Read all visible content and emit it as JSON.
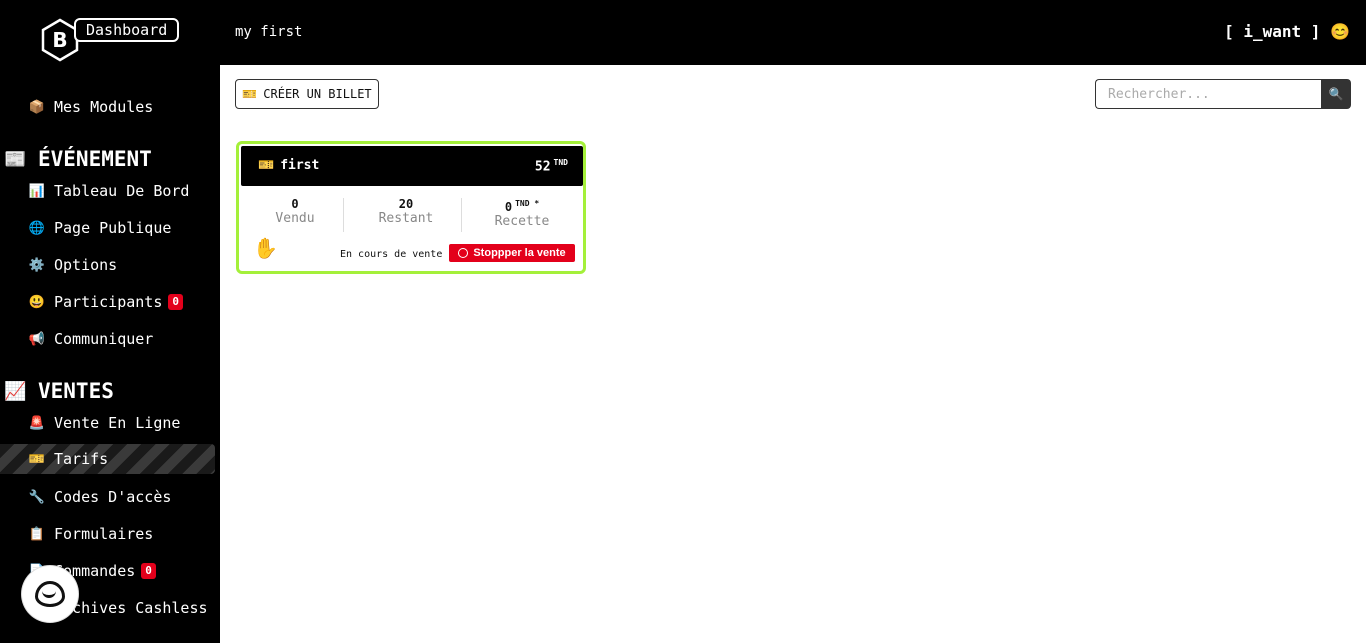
{
  "brand": {
    "logo_text": "Dashboard",
    "logo_letter": "B"
  },
  "topbar": {
    "event_name": "my first",
    "user": "[ i_want ] 😊"
  },
  "sidebar": {
    "modules": {
      "icon": "📦",
      "label": "Mes Modules"
    },
    "section_event": {
      "icon": "📰",
      "label": "ÉVÉNEMENT"
    },
    "event_items": [
      {
        "icon": "📊",
        "label": "Tableau De Bord"
      },
      {
        "icon": "🌐",
        "label": "Page Publique"
      },
      {
        "icon": "⚙️",
        "label": "Options"
      },
      {
        "icon": "😃",
        "label": "Participants",
        "badge": "0"
      },
      {
        "icon": "📢",
        "label": "Communiquer"
      }
    ],
    "section_sales": {
      "icon": "📈",
      "label": "VENTES"
    },
    "sales_items": [
      {
        "icon": "🚨",
        "label": "Vente En Ligne"
      },
      {
        "icon": "🎫",
        "label": "Tarifs"
      },
      {
        "icon": "🔧",
        "label": "Codes D'accès"
      },
      {
        "icon": "📋",
        "label": "Formulaires"
      },
      {
        "icon": "📄",
        "label": "Commandes",
        "badge": "0"
      },
      {
        "icon": "📄",
        "label": "Archives Cashless"
      }
    ]
  },
  "toolbar": {
    "create_icon": "🎫",
    "create_label": "CRÉER UN BILLET",
    "search_placeholder": "Rechercher...",
    "search_icon": "🔍"
  },
  "ticket": {
    "icon": "🎫",
    "name": "first",
    "price": "52",
    "currency": "TND",
    "sold_value": "0",
    "sold_label": "Vendu",
    "remaining_value": "20",
    "remaining_label": "Restant",
    "revenue_value": "0",
    "revenue_currency": "TND *",
    "revenue_label": "Recette",
    "hand_icon": "✋",
    "status": "En cours de vente",
    "stop_label": "Stoppper la vente"
  }
}
